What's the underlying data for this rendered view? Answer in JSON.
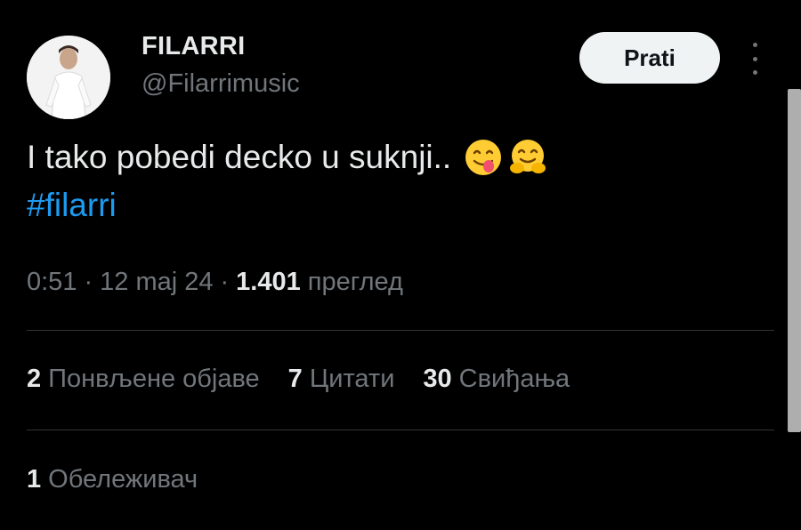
{
  "author": {
    "name": "FILARRI",
    "handle": "@Filarrimusic"
  },
  "follow_button": {
    "label": "Prati"
  },
  "tweet": {
    "text": "I tako pobedi decko u suknji..",
    "emojis": [
      "yum-face-icon",
      "hugging-face-icon"
    ],
    "hashtag": "#filarri"
  },
  "meta": {
    "time": "0:51",
    "separator": "·",
    "date": "12 maj 24",
    "views_count": "1.401",
    "views_label": "преглед"
  },
  "stats": {
    "reposts": {
      "count": "2",
      "label": "Понвљене објаве"
    },
    "quotes": {
      "count": "7",
      "label": "Цитати"
    },
    "likes": {
      "count": "30",
      "label": "Свиђања"
    },
    "bookmarks": {
      "count": "1",
      "label": "Обележивач"
    }
  },
  "colors": {
    "background": "#000000",
    "text": "#e7e9ea",
    "muted": "#71767b",
    "link": "#1d9bf0",
    "button_bg": "#eff3f4"
  }
}
